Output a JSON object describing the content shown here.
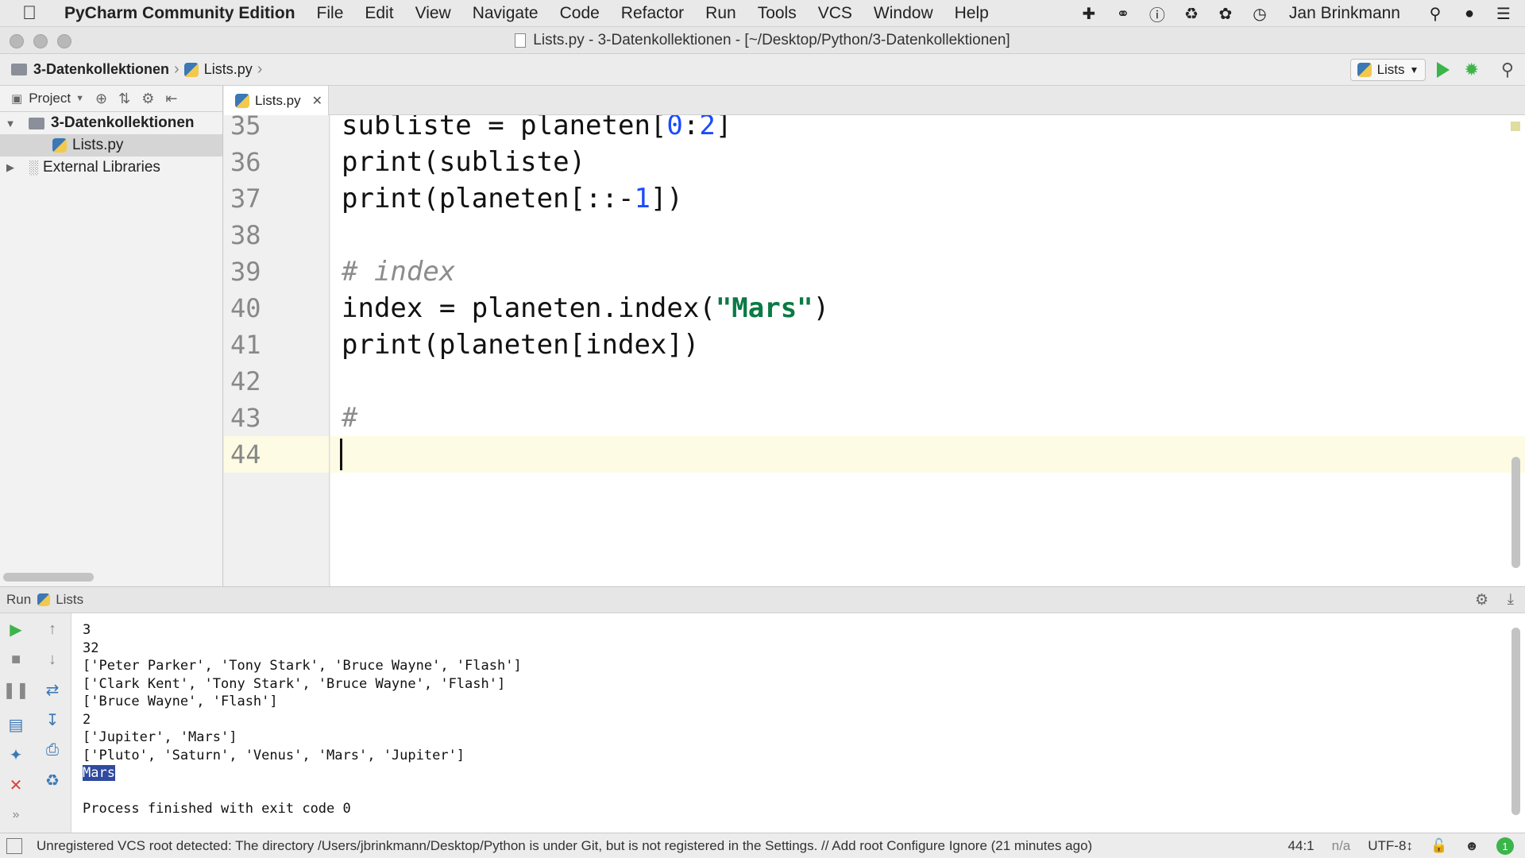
{
  "menubar": {
    "app_name": "PyCharm Community Edition",
    "items": [
      "File",
      "Edit",
      "View",
      "Navigate",
      "Code",
      "Refactor",
      "Run",
      "Tools",
      "VCS",
      "Window",
      "Help"
    ],
    "user": "Jan Brinkmann"
  },
  "window": {
    "title": "Lists.py - 3-Datenkollektionen - [~/Desktop/Python/3-Datenkollektionen]"
  },
  "navbar": {
    "breadcrumb_folder": "3-Datenkollektionen",
    "breadcrumb_file": "Lists.py",
    "run_config": "Lists"
  },
  "project": {
    "label": "Project",
    "tree": [
      {
        "label": "3-Datenkollektionen",
        "bold": true
      },
      {
        "label": "Lists.py"
      },
      {
        "label": "External Libraries"
      }
    ]
  },
  "editor": {
    "tab_label": "Lists.py",
    "lines": [
      {
        "num": "35",
        "parts": [
          [
            "plain",
            "subliste = planeten["
          ],
          [
            "num",
            "0"
          ],
          [
            "plain",
            ":"
          ],
          [
            "num",
            "2"
          ],
          [
            "plain",
            "]"
          ]
        ]
      },
      {
        "num": "36",
        "parts": [
          [
            "plain",
            "print(subliste)"
          ]
        ]
      },
      {
        "num": "37",
        "parts": [
          [
            "plain",
            "print(planeten[::-"
          ],
          [
            "num",
            "1"
          ],
          [
            "plain",
            "])"
          ]
        ]
      },
      {
        "num": "38",
        "parts": []
      },
      {
        "num": "39",
        "parts": [
          [
            "comment",
            "# index"
          ]
        ]
      },
      {
        "num": "40",
        "parts": [
          [
            "plain",
            "index = planeten.index("
          ],
          [
            "str",
            "\"Mars\""
          ],
          [
            "plain",
            ")"
          ]
        ]
      },
      {
        "num": "41",
        "parts": [
          [
            "plain",
            "print(planeten[index])"
          ]
        ]
      },
      {
        "num": "42",
        "parts": []
      },
      {
        "num": "43",
        "parts": [
          [
            "comment",
            "#"
          ]
        ]
      },
      {
        "num": "44",
        "parts": []
      }
    ],
    "current_line": "44"
  },
  "run_panel": {
    "label": "Run",
    "config": "Lists",
    "output": [
      "3",
      "32",
      "['Peter Parker', 'Tony Stark', 'Bruce Wayne', 'Flash']",
      "['Clark Kent', 'Tony Stark', 'Bruce Wayne', 'Flash']",
      "['Bruce Wayne', 'Flash']",
      "2",
      "['Jupiter', 'Mars']",
      "['Pluto', 'Saturn', 'Venus', 'Mars', 'Jupiter']",
      "Mars",
      "",
      "Process finished with exit code 0"
    ],
    "highlighted_line": "Mars"
  },
  "statusbar": {
    "message": "Unregistered VCS root detected: The directory /Users/jbrinkmann/Desktop/Python is under Git, but is not registered in the Settings. // Add root  Configure  Ignore (21 minutes ago)",
    "position": "44:1",
    "na": "n/a",
    "encoding": "UTF-8↕"
  },
  "colors": {
    "accent_green": "#3bb54a",
    "number_blue": "#1a4bff",
    "string_green": "#0a7a45",
    "comment_gray": "#8c8c8c",
    "selection_blue": "#2f4a9e"
  },
  "icons": [
    "apple-icon",
    "folder-icon",
    "python-file-icon",
    "play-icon",
    "debug-icon",
    "search-icon",
    "gear-icon",
    "close-icon",
    "stop-icon",
    "pause-icon",
    "print-icon",
    "trash-icon"
  ]
}
